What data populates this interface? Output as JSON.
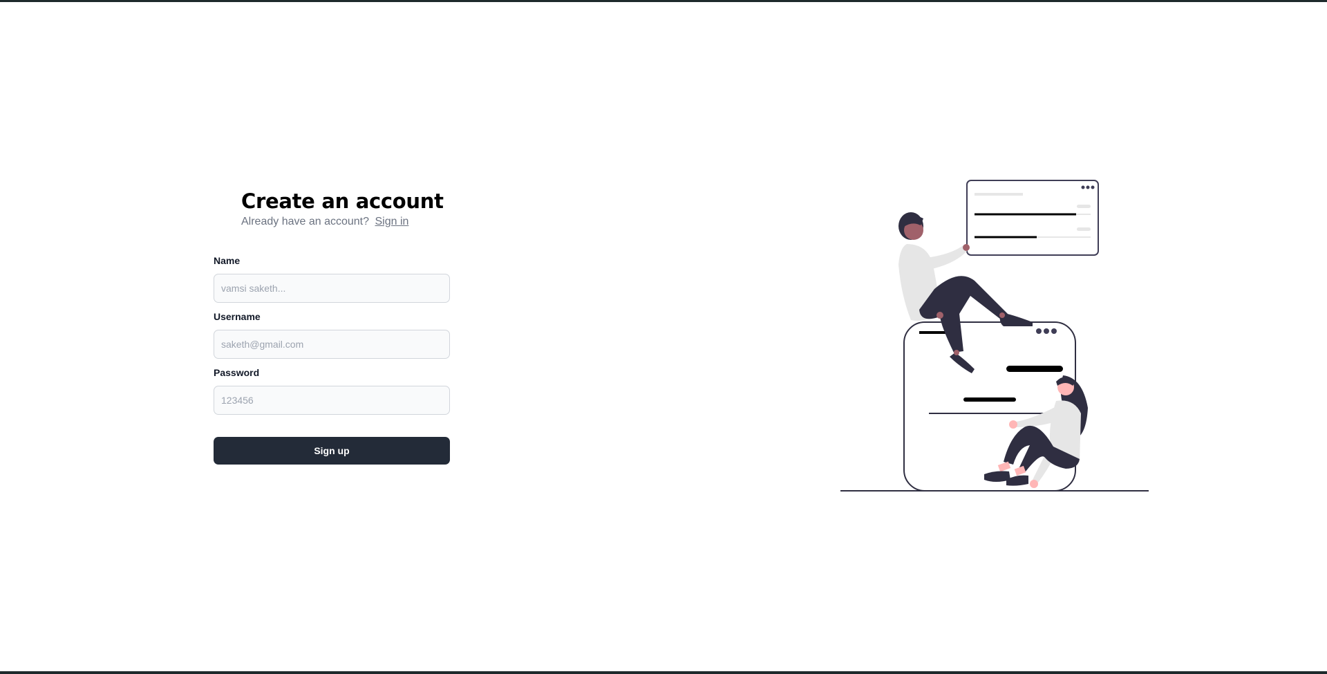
{
  "signup": {
    "title": "Create an account",
    "subtitle": "Already have an account?",
    "signin_link": "Sign in",
    "fields": {
      "name": {
        "label": "Name",
        "placeholder": "vamsi saketh..."
      },
      "username": {
        "label": "Username",
        "placeholder": "saketh@gmail.com"
      },
      "password": {
        "label": "Password",
        "placeholder": "123456"
      }
    },
    "submit_label": "Sign up"
  },
  "colors": {
    "button_bg": "#232b38",
    "muted_text": "#6b7280",
    "input_bg": "#f9fafb",
    "illustration_dark": "#2f2e41",
    "illustration_skin": "#ffb6b6"
  },
  "illustration": {
    "icon": "people-with-ui-cards-illustration"
  }
}
